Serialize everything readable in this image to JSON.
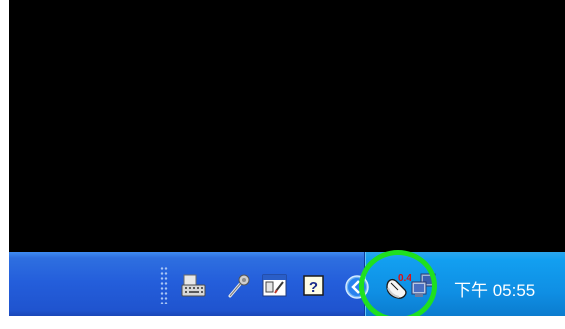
{
  "screen": {
    "background": "#000000"
  },
  "taskbar": {
    "color": "#245edb",
    "language_bar": {
      "items": [
        {
          "icon": "keyboard-icon"
        },
        {
          "icon": "microphone-icon"
        },
        {
          "icon": "handwriting-pad-icon"
        },
        {
          "icon": "help-icon",
          "label": "?"
        }
      ]
    },
    "tray": {
      "color": "#0f8fe4",
      "expand_icon": "chevron-left-icon",
      "icons": [
        {
          "icon": "mouse-utility-icon",
          "label": "0.4"
        },
        {
          "icon": "network-connection-icon"
        }
      ],
      "clock": "下午 05:55"
    }
  },
  "highlight": {
    "color": "#1fe01f"
  }
}
